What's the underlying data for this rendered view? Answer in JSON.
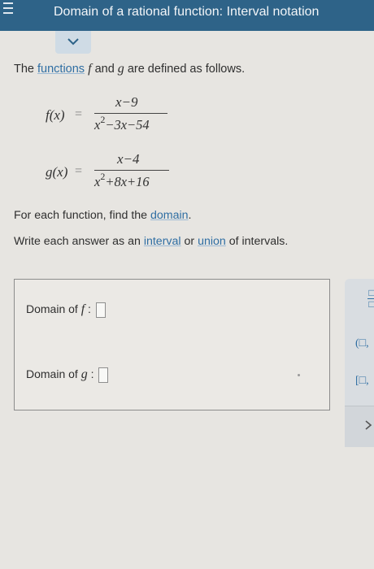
{
  "header": {
    "title": "Domain of a rational function: Interval notation"
  },
  "intro": {
    "prefix": "The ",
    "link": "functions",
    "f_var": "f",
    "middle": " and ",
    "g_var": "g",
    "suffix": " are defined as follows."
  },
  "functions": {
    "f": {
      "lhs": "f(x)",
      "equals": "=",
      "numerator": "x−9",
      "den_base": "x",
      "den_exp": "2",
      "den_rest": "−3x−54"
    },
    "g": {
      "lhs": "g(x)",
      "equals": "=",
      "numerator": "x−4",
      "den_base": "x",
      "den_exp": "2",
      "den_rest": "+8x+16"
    }
  },
  "instructions": {
    "line1_prefix": "For each function, find the ",
    "line1_link": "domain",
    "line1_suffix": ".",
    "line2_prefix": "Write each answer as an ",
    "line2_link1": "interval",
    "line2_middle": " or ",
    "line2_link2": "union",
    "line2_suffix": " of intervals."
  },
  "answers": {
    "f_label": "Domain of ",
    "f_var": "f",
    "f_colon": " :",
    "f_value": "",
    "g_label": "Domain of ",
    "g_var": "g",
    "g_colon": " :",
    "g_value": ""
  },
  "toolbar": {
    "fraction_top": "□",
    "fraction_bottom": "□",
    "open_interval": "(□,",
    "closed_interval": "[□,"
  },
  "colors": {
    "header_bg": "#2e6388",
    "link": "#2f6ea3",
    "page_bg": "#e7e5e1"
  },
  "icons": [
    "menu-icon",
    "chevron-down-icon",
    "chevron-right-icon"
  ]
}
